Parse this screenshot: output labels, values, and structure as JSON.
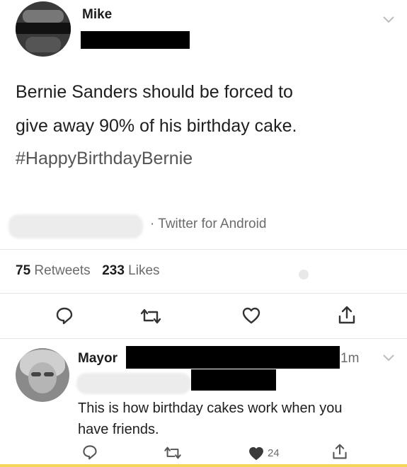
{
  "tweet": {
    "author_name": "Mike",
    "text_line1": "Bernie Sanders should be forced to",
    "text_line2": "give away 90% of his birthday cake.",
    "hashtag": "#HappyBirthdayBernie",
    "source": "· Twitter for Android",
    "stats": {
      "retweets_count": "75",
      "retweets_label": "Retweets",
      "likes_count": "233",
      "likes_label": "Likes"
    },
    "actions": [
      "reply-icon",
      "retweet-icon",
      "like-icon",
      "share-icon"
    ]
  },
  "reply": {
    "author_name": "Mayor",
    "time": "1m",
    "text_line1": "This is how birthday cakes work when you",
    "text_line2": "have friends.",
    "like_count": "24",
    "actions": [
      "reply-icon",
      "retweet-icon",
      "liked-heart-icon",
      "share-icon"
    ]
  },
  "colors": {
    "text": "#222222",
    "muted": "#6b6b6b",
    "divider": "#e6e6e6",
    "redaction": "#000000",
    "bottom_border": "#f3d65a"
  }
}
